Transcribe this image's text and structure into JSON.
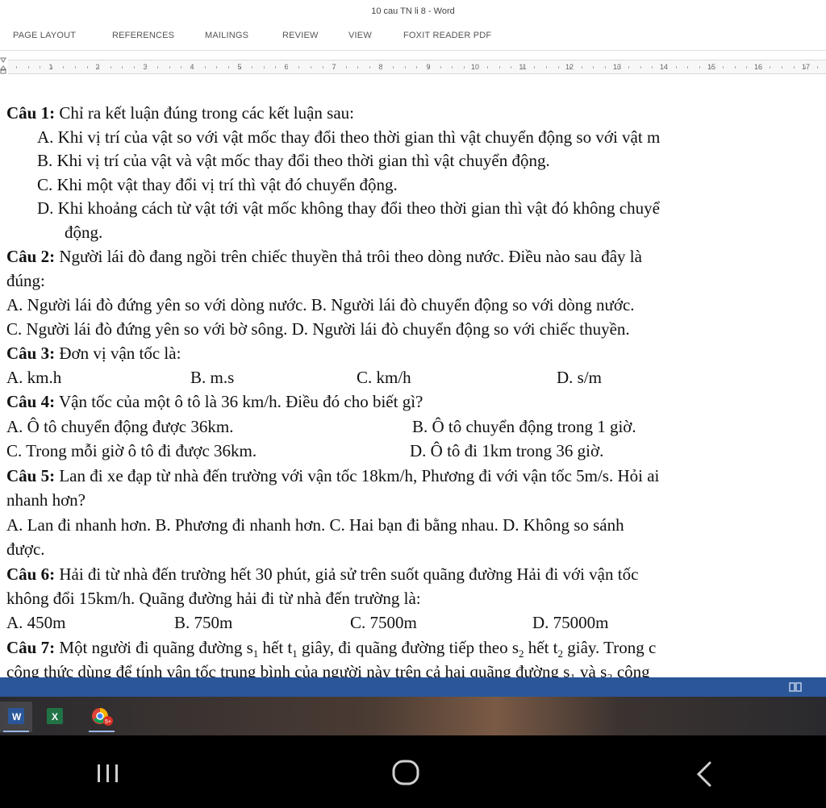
{
  "window": {
    "title": "10 cau TN li 8 - Word"
  },
  "ribbon": {
    "tabs": [
      "PAGE LAYOUT",
      "REFERENCES",
      "MAILINGS",
      "REVIEW",
      "VIEW",
      "FOXIT READER PDF"
    ]
  },
  "ruler": {
    "numbers": [
      "1",
      "2",
      "3",
      "4",
      "5",
      "6",
      "7",
      "8",
      "9",
      "10",
      "11",
      "12",
      "13",
      "14",
      "15",
      "16",
      "17"
    ]
  },
  "document": {
    "q1": {
      "label": "Câu 1:",
      "text": " Chỉ ra kết luận đúng trong các kết luận sau:",
      "a": "A. Khi vị trí của vật so với vật mốc thay đổi theo thời gian thì vật chuyển động so với vật m",
      "b": "B. Khi vị trí của vật và vật mốc thay đổi theo thời gian thì vật chuyển động.",
      "c": "C. Khi một vật thay đổi vị trí thì vật đó chuyển động.",
      "d": "D. Khi khoảng cách từ vật tới vật mốc không thay đổi theo thời gian thì vật đó không chuyể",
      "d2": "động."
    },
    "q2": {
      "label": "Câu 2:",
      "text": " Người lái đò đang ngồi trên chiếc thuyền thả trôi theo dòng nước. Điều nào sau đây là",
      "text2": "đúng:",
      "ab": "A. Người lái đò đứng yên so với dòng nước.  B. Người lái đò chuyển động so với dòng nước.",
      "cd": "C. Người lái đò đứng yên so với bờ sông.    D. Người lái đò chuyển động so với chiếc thuyền."
    },
    "q3": {
      "label": "Câu 3:",
      "text": " Đơn vị vận tốc là:",
      "a": "A. km.h",
      "b": "B. m.s",
      "c": "C. km/h",
      "d": "D. s/m"
    },
    "q4": {
      "label": "Câu 4:",
      "text": " Vận tốc của một ô tô là 36 km/h. Điều đó cho biết gì?",
      "a": "A. Ô tô chuyển động được 36km.",
      "b": "B. Ô tô chuyển động trong 1 giờ.",
      "c": "C. Trong mỗi giờ ô tô đi được 36km.",
      "d": "D. Ô tô đi 1km trong 36 giờ."
    },
    "q5": {
      "label": "Câu 5:",
      "text": " Lan đi xe đạp từ nhà đến trường với vận tốc 18km/h, Phương đi với vận tốc 5m/s. Hỏi ai",
      "text2": "nhanh hơn?",
      "opts": "A. Lan đi nhanh hơn.   B. Phương đi nhanh hơn.   C. Hai bạn đi bằng nhau.   D. Không so sánh",
      "opts2": "được."
    },
    "q6": {
      "label": "Câu 6:",
      "text": " Hải đi từ  nhà đến trường hết 30 phút, giả sử trên suốt quãng đường Hải đi với vận tốc",
      "text2": "không đổi 15km/h. Quãng đường hải đi từ nhà đến trường là:",
      "a": "A. 450m",
      "b": "B. 750m",
      "c": "C. 7500m",
      "d": "D. 75000m"
    },
    "q7": {
      "label": "Câu 7:",
      "p1": " Một người đi quãng đường s",
      "s1": "1",
      "p2": " hết t",
      "t1": "1",
      "p3": " giây, đi quãng đường tiếp theo s",
      "s2": "2",
      "p4": " hết t",
      "t2": "2",
      "p5": " giây. Trong c",
      "line2": "công thức dùng để tính vận tốc trung bình của người này trên cả hai quãng đường s₁ và s₂ công"
    }
  },
  "taskbar": {
    "apps": [
      {
        "icon": "word-icon",
        "color": "#2b579a"
      },
      {
        "icon": "excel-icon",
        "color": "#217346"
      },
      {
        "icon": "chrome-icon",
        "color": "#db4437",
        "badge": "5+"
      }
    ]
  },
  "colors": {
    "accent": "#2b579a",
    "navbar": "#000000"
  }
}
